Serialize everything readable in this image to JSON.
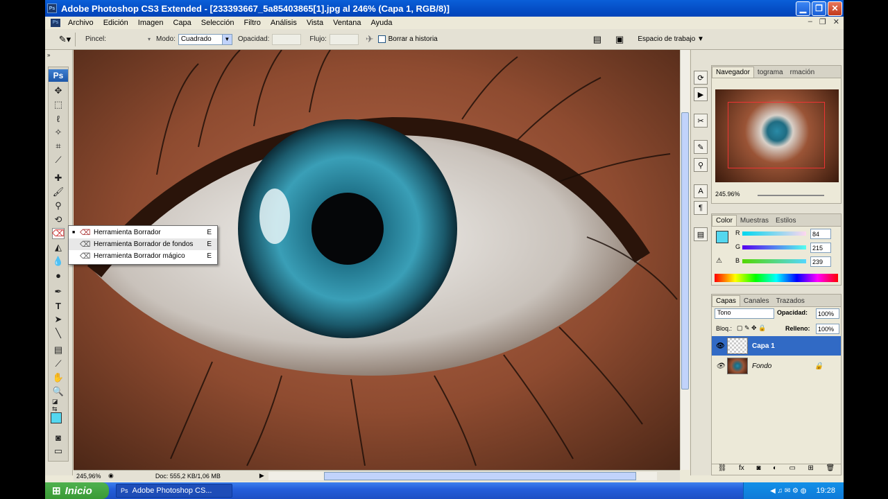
{
  "window": {
    "title": "Adobe Photoshop CS3 Extended - [233393667_5a85403865[1].jpg al 246% (Capa 1, RGB/8)]",
    "app_icon": "Ps"
  },
  "menu": [
    "Archivo",
    "Edición",
    "Imagen",
    "Capa",
    "Selección",
    "Filtro",
    "Análisis",
    "Vista",
    "Ventana",
    "Ayuda"
  ],
  "options": {
    "pincel_label": "Pincel:",
    "modo_label": "Modo:",
    "modo_value": "Cuadrado",
    "opacidad_label": "Opacidad:",
    "flujo_label": "Flujo:",
    "borrar_historia": "Borrar a historia",
    "workspace": "Espacio de trabajo"
  },
  "toolbox": {
    "logo": "Ps",
    "foreground_color": "#54d7ef"
  },
  "eraser_menu": [
    {
      "label": "Herramienta Borrador",
      "key": "E",
      "icon": "eraser-icon"
    },
    {
      "label": "Herramienta Borrador de fondos",
      "key": "E",
      "icon": "background-eraser-icon"
    },
    {
      "label": "Herramienta Borrador mágico",
      "key": "E",
      "icon": "magic-eraser-icon"
    }
  ],
  "status": {
    "zoom": "245,96%",
    "doc": "Doc: 555,2 KB/1,06 MB"
  },
  "navigator": {
    "tabs": [
      "Navegador",
      "tograma",
      "rmación"
    ],
    "zoom": "245.96%"
  },
  "color_panel": {
    "tabs": [
      "Color",
      "Muestras",
      "Estilos"
    ],
    "r_label": "R",
    "r": "84",
    "g_label": "G",
    "g": "215",
    "b_label": "B",
    "b": "239",
    "swatch": "#54d7ef"
  },
  "layers_panel": {
    "tabs": [
      "Capas",
      "Canales",
      "Trazados"
    ],
    "blend": "Tono",
    "opacidad_label": "Opacidad:",
    "opacidad": "100%",
    "bloq_label": "Bloq.:",
    "relleno_label": "Relleno:",
    "relleno": "100%",
    "layers": [
      {
        "name": "Capa 1",
        "selected": true
      },
      {
        "name": "Fondo",
        "selected": false
      }
    ]
  },
  "taskbar": {
    "start": "Inicio",
    "task": "Adobe Photoshop CS...",
    "clock": "19:28"
  }
}
